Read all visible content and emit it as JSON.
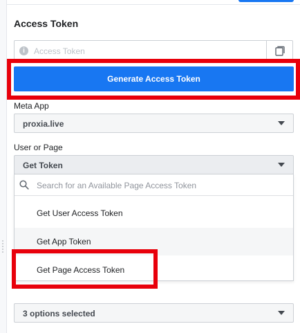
{
  "access_token": {
    "title": "Access Token",
    "placeholder": "Access Token",
    "generate_label": "Generate Access Token"
  },
  "meta_app": {
    "label": "Meta App",
    "selected": "proxia.live"
  },
  "user_or_page": {
    "label": "User or Page",
    "selected": "Get Token",
    "search_placeholder": "Search for an Available Page Access Token",
    "options": [
      {
        "label": "Get User Access Token"
      },
      {
        "label": "Get App Token"
      },
      {
        "label": "Get Page Access Token"
      }
    ]
  },
  "permissions": {
    "selected": "3 options selected"
  },
  "colors": {
    "primary": "#1877f2",
    "highlight": "#e8000b"
  },
  "icons": [
    "info-icon",
    "copy-icon",
    "search-icon",
    "chevron-down-icon"
  ]
}
